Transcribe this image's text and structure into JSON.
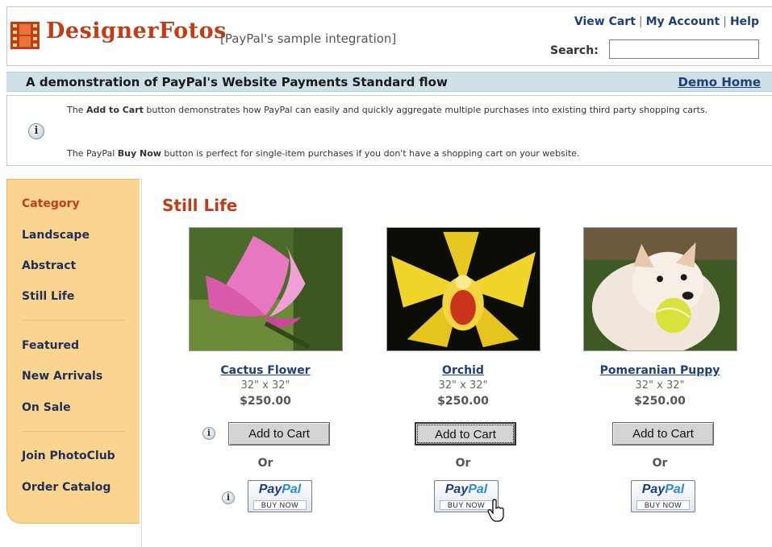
{
  "header": {
    "logo_text": "DesignerFotos",
    "subtitle": "[PayPal's sample integration]",
    "links": [
      "View Cart",
      "My Account",
      "Help"
    ],
    "search_label": "Search:",
    "search_value": ""
  },
  "banner": {
    "title": "A demonstration of PayPal's Website Payments Standard flow",
    "demo_link": "Demo Home"
  },
  "info": {
    "line1_pre": "The ",
    "line1_bold": "Add to Cart",
    "line1_post": " button demonstrates how PayPal can easily and quickly aggregate multiple purchases into existing third party shopping carts.",
    "line2_pre": "The PayPal ",
    "line2_bold": "Buy Now",
    "line2_post": " button is perfect for single-item purchases if you don't have a shopping cart on your website."
  },
  "sidebar": {
    "heading": "Category",
    "group1": [
      "Landscape",
      "Abstract",
      "Still Life"
    ],
    "group2": [
      "Featured",
      "New Arrivals",
      "On Sale"
    ],
    "group3": [
      "Join PhotoClub",
      "Order Catalog"
    ]
  },
  "section_title": "Still Life",
  "products": [
    {
      "name": "Cactus Flower",
      "size": "32\" x 32\"",
      "price": "$250.00",
      "add_label": "Add to Cart",
      "or_label": "Or",
      "paypal_label": "PayPal",
      "buy_label": "BUY NOW"
    },
    {
      "name": "Orchid",
      "size": "32\" x 32\"",
      "price": "$250.00",
      "add_label": "Add to Cart",
      "or_label": "Or",
      "paypal_label": "PayPal",
      "buy_label": "BUY NOW"
    },
    {
      "name": "Pomeranian Puppy",
      "size": "32\" x 32\"",
      "price": "$250.00",
      "add_label": "Add to Cart",
      "or_label": "Or",
      "paypal_label": "PayPal",
      "buy_label": "BUY NOW"
    }
  ],
  "icons": {
    "info": "info-icon",
    "logo": "film-strip-icon",
    "cursor": "hand-pointer-icon"
  },
  "colors": {
    "brand": "#c23c16",
    "link": "#1f3f7a",
    "sidebar_bg": "#fbd58f",
    "banner_bg": "#cfe0e8",
    "paypal_blue": "#1a3c88"
  }
}
